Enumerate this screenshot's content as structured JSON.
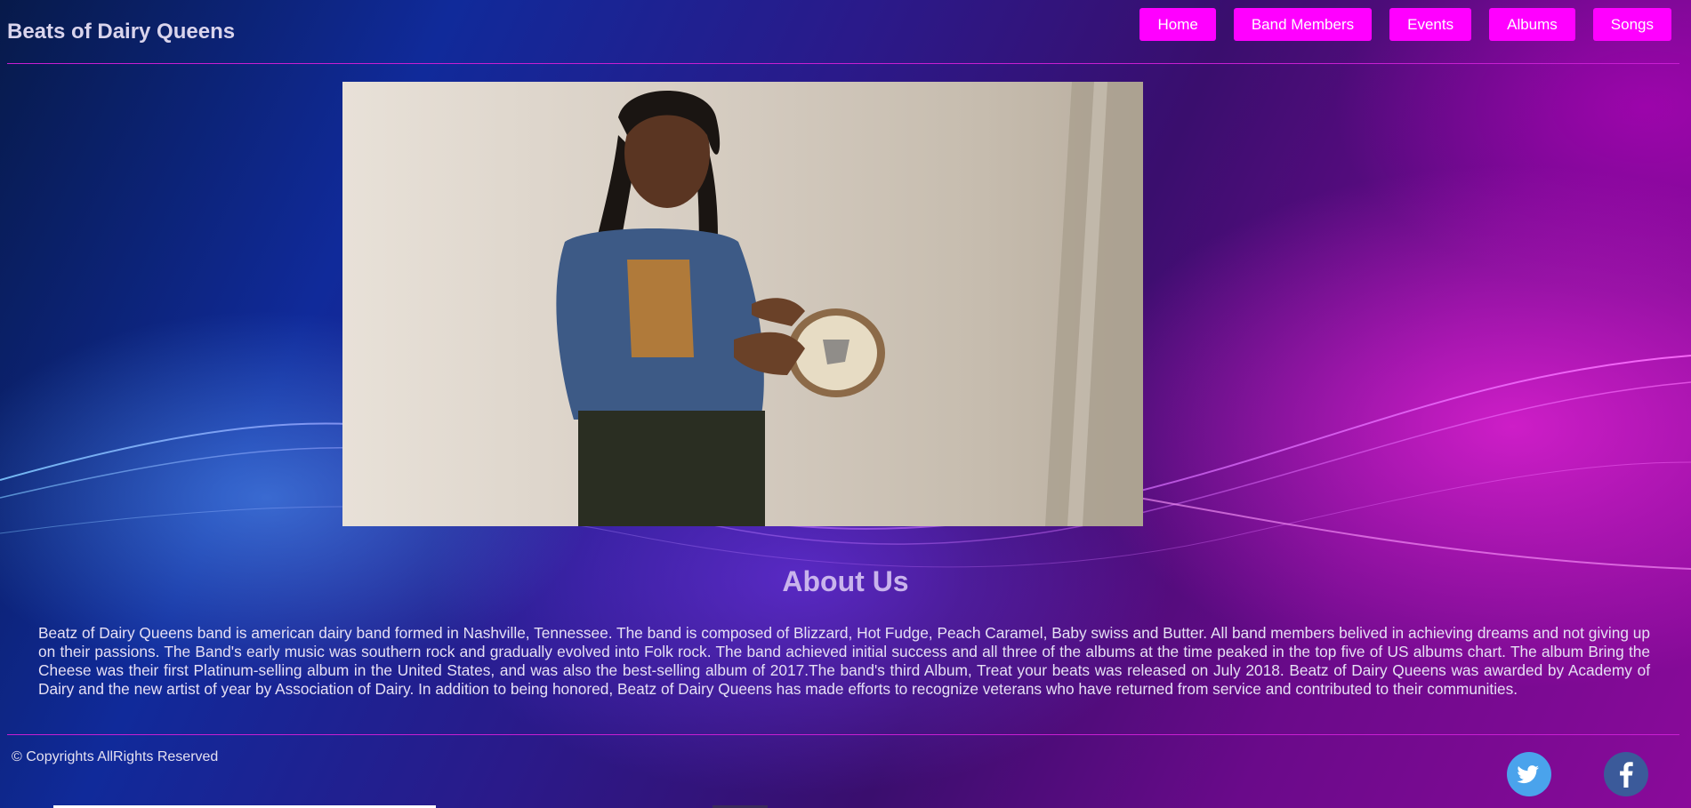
{
  "site": {
    "title": "Beats of Dairy Queens"
  },
  "nav": {
    "items": [
      {
        "label": "Home"
      },
      {
        "label": "Band Members"
      },
      {
        "label": "Events"
      },
      {
        "label": "Albums"
      },
      {
        "label": "Songs"
      }
    ]
  },
  "hero": {
    "image": "band-member-holding-tambourine-photo"
  },
  "about": {
    "title": "About Us",
    "text": "Beatz of Dairy Queens band is american dairy band formed in Nashville, Tennessee. The band is composed of Blizzard, Hot Fudge, Peach Caramel, Baby swiss and Butter. All band members belived in achieving dreams and not giving up on their passions. The Band's early music was southern rock and gradually evolved into Folk rock. The band achieved initial success and all three of the albums at the time peaked in the top five of US albums chart. The album Bring the Cheese was their first Platinum-selling album in the United States, and was also the best-selling album of 2017.The band's third Album, Treat your beats was released on July 2018. Beatz of Dairy Queens was awarded by Academy of Dairy and the new artist of year by Association of Dairy. In addition to being honored, Beatz of Dairy Queens has made efforts to recognize veterans who have returned from service and contributed to their communities."
  },
  "footer": {
    "copyright": "© Copyrights AllRights Reserved",
    "social": [
      {
        "icon": "twitter-icon",
        "color": "#4aa3ec"
      },
      {
        "icon": "facebook-icon",
        "color": "#3b5a9a"
      }
    ]
  },
  "colors": {
    "nav_button": "#ff00ff",
    "rule": "#c81ed2"
  }
}
